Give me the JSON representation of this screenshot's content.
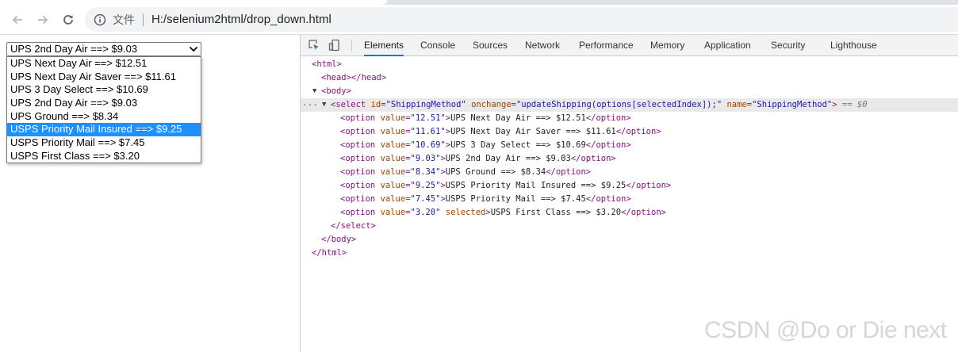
{
  "browser": {
    "site_label": "文件",
    "url": "H:/selenium2html/drop_down.html"
  },
  "page": {
    "select_value": "UPS 2nd Day Air ==> $9.03",
    "options": [
      "UPS Next Day Air ==> $12.51",
      "UPS Next Day Air Saver ==> $11.61",
      "UPS 3 Day Select ==> $10.69",
      "UPS 2nd Day Air ==> $9.03",
      "UPS Ground ==> $8.34",
      "USPS Priority Mail Insured ==> $9.25",
      "USPS Priority Mail ==> $7.45",
      "USPS First Class ==> $3.20"
    ],
    "highlighted_index": 5
  },
  "devtools": {
    "tabs": [
      "Elements",
      "Console",
      "Sources",
      "Network",
      "Performance",
      "Memory",
      "Application",
      "Security",
      "Lighthouse"
    ],
    "active_tab": "Elements",
    "tree": {
      "html_open": "<html>",
      "head": "<head></head>",
      "body_open": "<body>",
      "select_open_tag": "<select",
      "select_attrs": [
        {
          "name": "id",
          "value": "\"ShippingMethod\""
        },
        {
          "name": "onchange",
          "value": "\"updateShipping(options[selectedIndex]);\""
        },
        {
          "name": "name",
          "value": "\"ShippingMethod\""
        }
      ],
      "select_suffix": "== $0",
      "option_rows": [
        {
          "value": "\"12.51\"",
          "text": "UPS Next Day Air ==> $12.51",
          "selected": false
        },
        {
          "value": "\"11.61\"",
          "text": "UPS Next Day Air Saver ==> $11.61",
          "selected": false
        },
        {
          "value": "\"10.69\"",
          "text": "UPS 3 Day Select ==> $10.69",
          "selected": false
        },
        {
          "value": "\"9.03\"",
          "text": "UPS 2nd Day Air ==> $9.03",
          "selected": false
        },
        {
          "value": "\"8.34\"",
          "text": "UPS Ground ==> $8.34",
          "selected": false
        },
        {
          "value": "\"9.25\"",
          "text": "USPS Priority Mail Insured ==> $9.25",
          "selected": false
        },
        {
          "value": "\"7.45\"",
          "text": "USPS Priority Mail ==> $7.45",
          "selected": false
        },
        {
          "value": "\"3.20\"",
          "text": "USPS First Class ==> $3.20",
          "selected": true
        }
      ],
      "select_close": "</select>",
      "body_close": "</body>",
      "html_close": "</html>"
    }
  },
  "watermark": "CSDN @Do or Die next",
  "colors": {
    "highlight": "#1e90ff",
    "tag": "#881280",
    "attr_name": "#994500",
    "attr_value": "#1a1aa6"
  }
}
